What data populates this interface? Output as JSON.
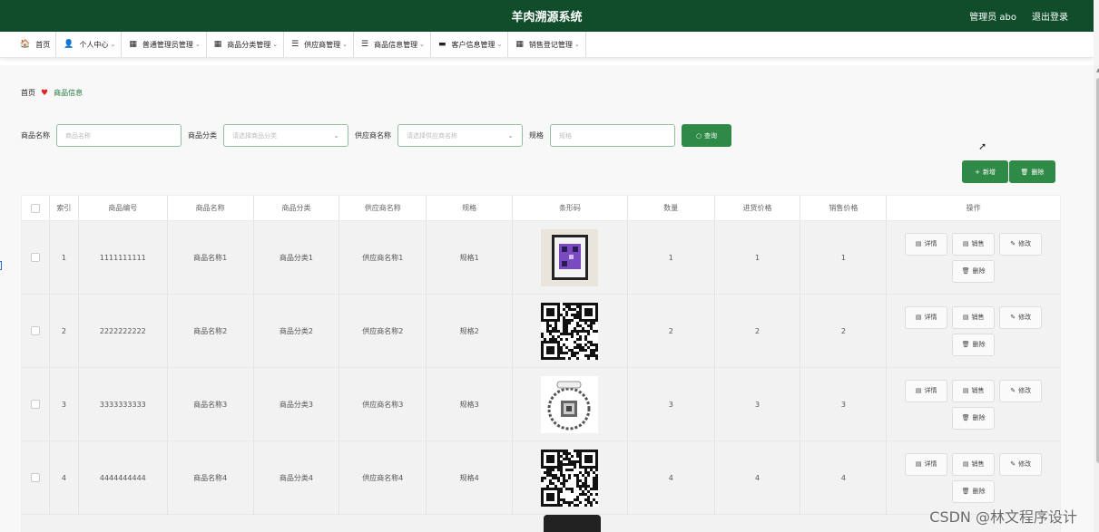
{
  "header": {
    "title": "羊肉溯源系统",
    "admin_label": "管理员 abo",
    "logout_label": "退出登录"
  },
  "menu": [
    {
      "icon": "home-icon",
      "glyph": "🏠",
      "label": "首页",
      "has_dropdown": false
    },
    {
      "icon": "user-icon",
      "glyph": "👤",
      "label": "个人中心",
      "has_dropdown": true
    },
    {
      "icon": "grid-icon",
      "glyph": "▦",
      "label": "普通管理员管理",
      "has_dropdown": true
    },
    {
      "icon": "grid-icon",
      "glyph": "▦",
      "label": "商品分类管理",
      "has_dropdown": true
    },
    {
      "icon": "list-icon",
      "glyph": "☰",
      "label": "供应商管理",
      "has_dropdown": true
    },
    {
      "icon": "list-icon",
      "glyph": "☰",
      "label": "商品信息管理",
      "has_dropdown": true
    },
    {
      "icon": "monitor-icon",
      "glyph": "▬",
      "label": "客户信息管理",
      "has_dropdown": true
    },
    {
      "icon": "grid-icon",
      "glyph": "▦",
      "label": "销售登记管理",
      "has_dropdown": true
    }
  ],
  "breadcrumb": {
    "home": "首页",
    "current": "商品信息"
  },
  "search": {
    "name_label": "商品名称",
    "name_placeholder": "商品名称",
    "category_label": "商品分类",
    "category_placeholder": "请选择商品分类",
    "supplier_label": "供应商名称",
    "supplier_placeholder": "请选择供应商名称",
    "spec_label": "规格",
    "spec_placeholder": "规格",
    "query_label": "查询"
  },
  "actions": {
    "add_label": "新增",
    "delete_label": "删除"
  },
  "table": {
    "headers": [
      "索引",
      "商品编号",
      "商品名称",
      "商品分类",
      "供应商名称",
      "规格",
      "条形码",
      "数量",
      "进货价格",
      "销售价格",
      "操作"
    ],
    "rows": [
      {
        "index": "1",
        "code": "1111111111",
        "name": "商品名称1",
        "category": "商品分类1",
        "supplier": "供应商名称1",
        "spec": "规格1",
        "qty": "1",
        "buy_price": "1",
        "sell_price": "1",
        "barcode_style": "framed-purple"
      },
      {
        "index": "2",
        "code": "2222222222",
        "name": "商品名称2",
        "category": "商品分类2",
        "supplier": "供应商名称2",
        "spec": "规格2",
        "qty": "2",
        "buy_price": "2",
        "sell_price": "2",
        "barcode_style": "qr"
      },
      {
        "index": "3",
        "code": "3333333333",
        "name": "商品名称3",
        "category": "商品分类3",
        "supplier": "供应商名称3",
        "spec": "规格3",
        "qty": "3",
        "buy_price": "3",
        "sell_price": "3",
        "barcode_style": "floral-qr"
      },
      {
        "index": "4",
        "code": "4444444444",
        "name": "商品名称4",
        "category": "商品分类4",
        "supplier": "供应商名称4",
        "spec": "规格4",
        "qty": "4",
        "buy_price": "4",
        "sell_price": "4",
        "barcode_style": "qr"
      }
    ],
    "row_ops": {
      "detail": "详情",
      "sell": "销售",
      "edit": "修改",
      "delete": "删除"
    }
  },
  "watermark": "CSDN @林文程序设计",
  "colors": {
    "header_bg": "#0f4d2b",
    "accent": "#2f8a48",
    "heart": "#e02424"
  }
}
